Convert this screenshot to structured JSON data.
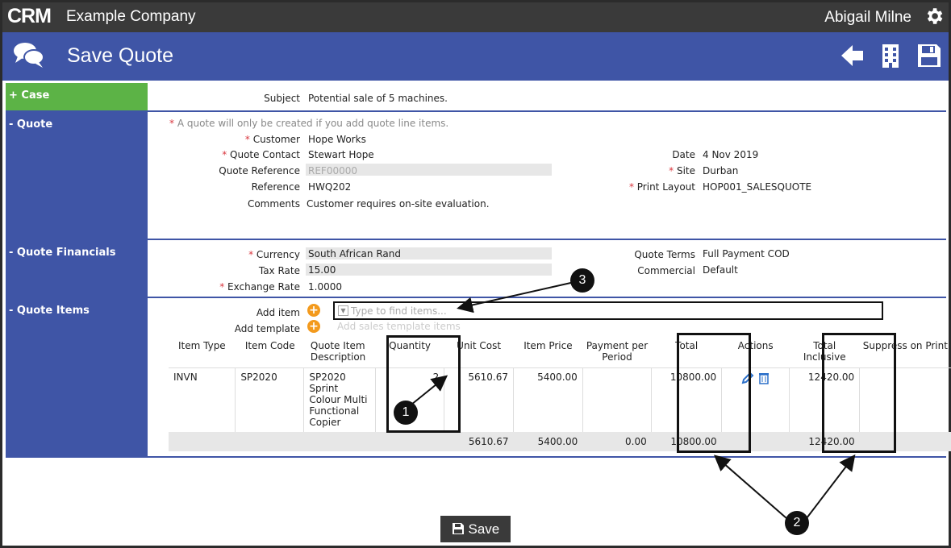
{
  "header": {
    "logo": "CRM",
    "company": "Example Company",
    "user": "Abigail Milne",
    "settings_icon": "gear-icon"
  },
  "titlebar": {
    "title": "Save Quote",
    "icons": [
      "chat-icon",
      "back-arrow-icon",
      "building-icon",
      "save-icon"
    ]
  },
  "sections": {
    "case": {
      "label": "+ Case",
      "subject_label": "Subject",
      "subject_value": "Potential sale of 5 machines."
    },
    "quote": {
      "label": "- Quote",
      "note": "A quote will only be created if you add quote line items.",
      "customer_label": "Customer",
      "customer_value": "Hope Works",
      "contact_label": "Quote Contact",
      "contact_value": "Stewart Hope",
      "qref_label": "Quote Reference",
      "qref_value": "REF00000",
      "ref_label": "Reference",
      "ref_value": "HWQ202",
      "comments_label": "Comments",
      "comments_value": "Customer requires on-site evaluation.",
      "date_label": "Date",
      "date_value": "4 Nov 2019",
      "site_label": "Site",
      "site_value": "Durban",
      "layout_label": "Print Layout",
      "layout_value": "HOP001_SALESQUOTE"
    },
    "financials": {
      "label": "- Quote Financials",
      "currency_label": "Currency",
      "currency_value": "South African Rand",
      "tax_label": "Tax Rate",
      "tax_value": "15.00",
      "exchange_label": "Exchange Rate",
      "exchange_value": "1.0000",
      "terms_label": "Quote Terms",
      "terms_value": "Full Payment COD",
      "commercial_label": "Commercial",
      "commercial_value": "Default"
    },
    "items": {
      "label": "- Quote Items",
      "add_item_label": "Add item",
      "add_item_placeholder": "Type to find items...",
      "add_template_label": "Add template",
      "add_template_placeholder": "Add sales template items",
      "columns": [
        "Item Type",
        "Item Code",
        "Quote Item Description",
        "Quantity",
        "Unit Cost",
        "Item Price",
        "Payment per Period",
        "Total",
        "Actions",
        "Total Inclusive",
        "Suppress on Print"
      ],
      "rows": [
        {
          "type": "INVN",
          "code": "SP2020",
          "description": "SP2020 Sprint Colour Multi Functional Copier",
          "quantity": "2",
          "unit_cost": "5610.67",
          "item_price": "5400.00",
          "payment": "",
          "total": "10800.00",
          "total_inclusive": "12420.00"
        }
      ],
      "footer": {
        "unit_cost": "5610.67",
        "item_price": "5400.00",
        "payment": "0.00",
        "total": "10800.00",
        "total_inclusive": "12420.00"
      }
    }
  },
  "callouts": {
    "one": "1",
    "two": "2",
    "three": "3"
  },
  "save_button": "Save"
}
